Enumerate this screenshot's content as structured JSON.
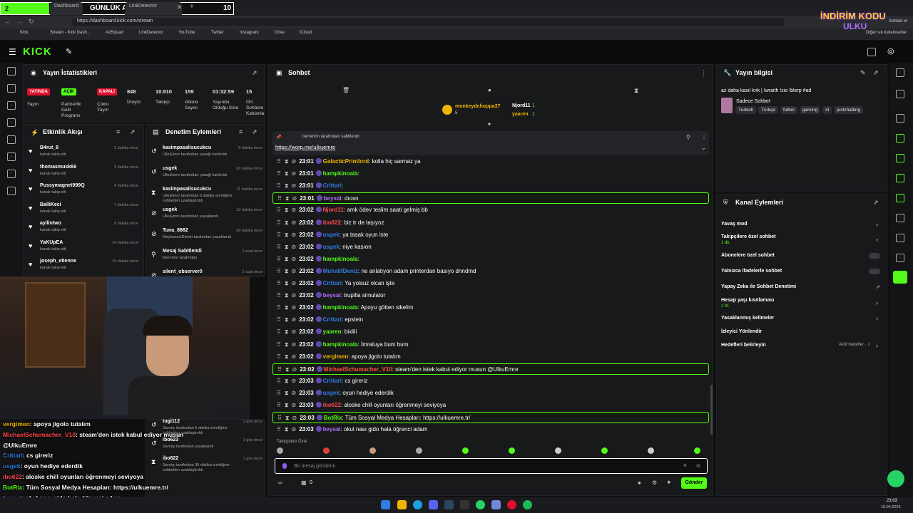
{
  "overlay_banner": {
    "left_num": "2",
    "title": "GÜNLÜK ABONE",
    "right_num": "10"
  },
  "browser": {
    "tabs": [
      "Dashboard",
      "Stream - Kick Dashboard",
      "LinkDetector"
    ],
    "url": "https://dashboard.kick.com/stream",
    "bookmarks": [
      "Kick",
      "Stream - Kick Dash...",
      "AdSquad",
      "LinkDetector",
      "YouTube",
      "Twitter",
      "Instagram",
      "Drive",
      "iCloud"
    ],
    "right": [
      "Sohbet et",
      "Diğer sık kullanılanlar"
    ]
  },
  "promo": {
    "line1": "İNDİRİM KODU",
    "line2": "ULKU"
  },
  "kick": {
    "logo": "KICK"
  },
  "stats": {
    "title": "Yayın İstatistikleri",
    "badges": [
      {
        "label": "YAYINDA",
        "sub": "Yayın",
        "color": "#e0102c"
      },
      {
        "label": "AÇIK",
        "sub": "Partnerlik Gelir Programı",
        "color": "#53fc18"
      },
      {
        "label": "KAPALI",
        "sub": "Çoklu Yayın",
        "color": "#e0102c"
      }
    ],
    "nums": [
      {
        "v": "848",
        "l": "İzleyici"
      },
      {
        "v": "10.910",
        "l": "Takipçi"
      },
      {
        "v": "159",
        "l": "Abone Sayısı"
      },
      {
        "v": "01:32:59",
        "l": "Yayında Olduğu Süre"
      },
      {
        "v": "15",
        "l": "Ort. Sohbete Katılanla"
      }
    ]
  },
  "activity": {
    "title": "Etkinlik Akışı",
    "items": [
      {
        "n": "B4rut_8",
        "d": "kanalı takip etti",
        "t": "2 dakika önce"
      },
      {
        "n": "thomasmusk69",
        "d": "kanalı takip etti",
        "t": "3 dakika önce"
      },
      {
        "n": "Pussymagnet999Q",
        "d": "kanalı takip etti",
        "t": "4 dakika önce"
      },
      {
        "n": "BalliKeci",
        "d": "kanalı takip etti",
        "t": "7 dakika önce"
      },
      {
        "n": "ayilintwo",
        "d": "kanalı takip etti",
        "t": "9 dakika önce"
      },
      {
        "n": "YaKUpEA",
        "d": "kanalı takip etti",
        "t": "14 dakika önce"
      },
      {
        "n": "joseph_etienne",
        "d": "kanalı takip etti",
        "t": "15 dakika önce"
      }
    ]
  },
  "moderation": {
    "title": "Denetim Eylemleri",
    "items": [
      {
        "n": "kasimpasalisucukcu",
        "d": "UlkuEmre tarafından yasağı kaldırıldı",
        "t": "9 dakika önce"
      },
      {
        "n": "usgek",
        "d": "UlkuEmre tarafından yasağı kaldırıldı",
        "t": "10 dakika önce"
      },
      {
        "n": "kasimpasalisucukcu",
        "d": "UlkuEmre tarafından 5 dakika süreliğine sohbetten uzaklaştırıldı",
        "t": "11 dakika önce"
      },
      {
        "n": "usgek",
        "d": "UlkuEmre tarafından yasaklandı",
        "t": "12 dakika önce"
      },
      {
        "n": "Tuna_8862",
        "d": "MeyhaneciDimitri tarafından yasaklandı",
        "t": "28 dakika önce"
      },
      {
        "n": "Mesaj Sabitlendi",
        "d": "berrennn tarafından",
        "t": "1 saat önce"
      },
      {
        "n": "silent_observer0",
        "d": "aloskecora tarafından yasaklandı",
        "t": "1 saat önce"
      }
    ],
    "lower": [
      {
        "n": "tugi112",
        "d": "Sarney tarafından 5 dakika süreliğine sohbetten uzaklaştırıldı",
        "t": "1 gün önce"
      },
      {
        "n": "ibo623",
        "d": "Sarney tarafından yasaklandı",
        "t": "1 gün önce"
      },
      {
        "n": "ibo622",
        "d": "Sarney tarafından 30 dakika süreliğine sohbetten uzaklaştırıldı",
        "t": "1 gün önce"
      }
    ]
  },
  "chat": {
    "title": "Sohbet",
    "top_users": [
      {
        "n": "monkeydchoppa37",
        "c": "5"
      },
      {
        "n": "Njord11",
        "c": "1"
      },
      {
        "n": "yaaren",
        "c": "1"
      }
    ],
    "pinned": {
      "by": "berrennn tarafından sabitlendi",
      "link": "https://worp.me/ulkuemre"
    },
    "messages": [
      {
        "t": "23:01",
        "u": "GalacticPrintlord",
        "c": "#f0b400",
        "m": ": kolla hiç sarmaz ya",
        "hl": false
      },
      {
        "t": "23:01",
        "u": "hampkinoala",
        "c": "#53fc18",
        "m": ":",
        "hl": false
      },
      {
        "t": "23:01",
        "u": "Crittari",
        "c": "#2f7de1",
        "m": ":",
        "hl": false
      },
      {
        "t": "23:01",
        "u": "beysal",
        "c": "#b36cff",
        "m": ": dıosn",
        "hl": true
      },
      {
        "t": "23:02",
        "u": "Njord11",
        "c": "#ff4a4a",
        "m": ": amk ödev teslim saati gelmiş bb",
        "hl": false
      },
      {
        "t": "23:02",
        "u": "ibo622",
        "c": "#ff4a4a",
        "m": ": biz tr de taşıyoz",
        "hl": false
      },
      {
        "t": "23:02",
        "u": "usgek",
        "c": "#2f7de1",
        "m": ": ya tasak oyun iste",
        "hl": false
      },
      {
        "t": "23:02",
        "u": "usgek",
        "c": "#2f7de1",
        "m": ": niye kasıon",
        "hl": false
      },
      {
        "t": "23:02",
        "u": "hampkinoala",
        "c": "#53fc18",
        "m": ":",
        "hl": false
      },
      {
        "t": "23:02",
        "u": "MuhalifDeniz",
        "c": "#2f7de1",
        "m": ": ne anlatıyon adam printerdan basıyo dnndmd",
        "hl": false
      },
      {
        "t": "23:02",
        "u": "Crittari",
        "c": "#2f7de1",
        "m": ": Ya yolsuz olcan işte",
        "hl": false
      },
      {
        "t": "23:02",
        "u": "beysal",
        "c": "#b36cff",
        "m": ": trupilla simulator",
        "hl": false
      },
      {
        "t": "23:02",
        "u": "hampkinoala",
        "c": "#53fc18",
        "m": ": Apoyu götten sikelim",
        "hl": false
      },
      {
        "t": "23:02",
        "u": "Crittari",
        "c": "#2f7de1",
        "m": ": epstein",
        "hl": false
      },
      {
        "t": "23:02",
        "u": "yaaren",
        "c": "#53fc18",
        "m": ": bixlili",
        "hl": false
      },
      {
        "t": "23:02",
        "u": "hampkinoala",
        "c": "#53fc18",
        "m": ": İmraluya bum bum",
        "hl": false
      },
      {
        "t": "23:02",
        "u": "vergimen",
        "c": "#f0b400",
        "m": ": apoya jigolo tutalım",
        "hl": false
      },
      {
        "t": "23:02",
        "u": "MichaelSchumacher_V10",
        "c": "#ff4a4a",
        "m": ": steam'den istek kabul ediyor musun @UlkuEmre",
        "hl": true
      },
      {
        "t": "23:03",
        "u": "Crittari",
        "c": "#2f7de1",
        "m": ": cs gireriz",
        "hl": false
      },
      {
        "t": "23:03",
        "u": "usgek",
        "c": "#2f7de1",
        "m": ": oyun hediye ederdik",
        "hl": false
      },
      {
        "t": "23:03",
        "u": "ibo622",
        "c": "#ff4a4a",
        "m": ": aloske chill oyunları öğrenmeyi seviyoya",
        "hl": false
      },
      {
        "t": "23:03",
        "u": "BotRix",
        "c": "#53fc18",
        "m": ": Tüm Sosyal Medya Hesapları: https://ulkuemre.tr/",
        "hl": true
      },
      {
        "t": "23:03",
        "u": "beysal",
        "c": "#b36cff",
        "m": ": okul nası gido hala öğrenci adam",
        "hl": false
      }
    ],
    "filter_label": "Takipçilere Özel",
    "placeholder": "Bir mesaj gönderin",
    "count": "0",
    "send": "Gönder"
  },
  "stream_info": {
    "title": "Yayın bilgisi",
    "stream_title": "az daha kasıl knk | !wraith !zio !blerp #ad",
    "category": "Sadece Sohbet",
    "tags": [
      "Turkish",
      "Türkçe",
      "futbol",
      "gaming",
      "irl",
      "justchatting"
    ]
  },
  "channel_actions": {
    "title": "Kanal Eylemleri",
    "items": [
      {
        "l": "Yavaş mod",
        "s": "",
        "ctl": "chev"
      },
      {
        "l": "Takipçilere özel sohbet",
        "s": "1 dk.",
        "ctl": "chev"
      },
      {
        "l": "Abonelere özel sohbet",
        "s": "",
        "ctl": "toggle"
      },
      {
        "l": "Yalnızca ifadelerle sohbet",
        "s": "",
        "ctl": "toggle"
      },
      {
        "l": "Yapay Zeka ile Sohbet Denetimi",
        "s": "",
        "ctl": "ext"
      },
      {
        "l": "Hesap yaşı kısıtlaması",
        "s": "1 hf.",
        "ctl": "chev"
      },
      {
        "l": "Yasaklanmış kelimeler",
        "s": "",
        "ctl": "chev"
      },
      {
        "l": "İzleyici Yönlendir",
        "s": "",
        "ctl": ""
      },
      {
        "l": "Hedefleri belirleyin",
        "s": "Aktif hedefler · 1",
        "ctl": "chev"
      }
    ]
  },
  "overlay_chat": [
    {
      "u": "vergimen",
      "c": "#f0b400",
      "m": ": apoya jigolo tutalım"
    },
    {
      "u": "MichaelSchumacher_V10",
      "c": "#ff4a4a",
      "m": ": steam'den istek kabul ediyor musun"
    },
    {
      "u": "",
      "c": "#fff",
      "m": "@UlkuEmre"
    },
    {
      "u": "Crittari",
      "c": "#2f7de1",
      "m": ": cs gireriz"
    },
    {
      "u": "usgek",
      "c": "#2f7de1",
      "m": ": oyun hediye ederdik"
    },
    {
      "u": "ibo622",
      "c": "#ff4a4a",
      "m": ": aloske chill oyunları öğrenmeyi seviyoya"
    },
    {
      "u": "BotRix",
      "c": "#53fc18",
      "m": ": Tüm Sosyal Medya Hesapları: https://ulkuemre.tr/"
    },
    {
      "u": "beysal",
      "c": "#b36cff",
      "m": ": okul nası gido hala öğrenci adam"
    }
  ],
  "clock": {
    "time": "23:03",
    "date": "10.04.2026"
  }
}
